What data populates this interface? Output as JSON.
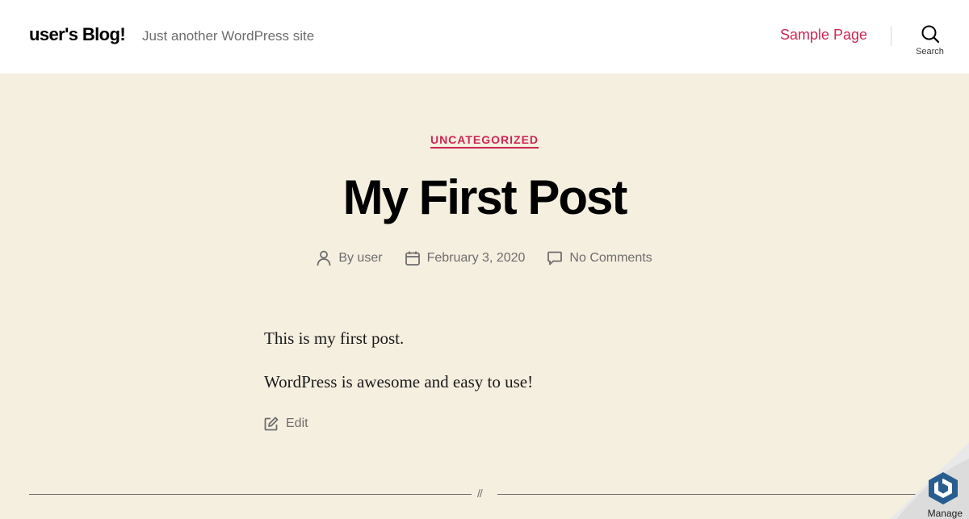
{
  "header": {
    "site_title": "user's Blog!",
    "tagline": "Just another WordPress site",
    "nav": [
      {
        "label": "Sample Page"
      }
    ],
    "search_label": "Search"
  },
  "post": {
    "category": "UNCATEGORIZED",
    "title": "My First Post",
    "meta": {
      "author": "By user",
      "date": "February 3, 2020",
      "comments": "No Comments"
    },
    "paragraphs": [
      "This is my first post.",
      "WordPress is awesome and easy to use!"
    ],
    "edit_label": "Edit"
  },
  "separator_mark": "//",
  "manage_badge": {
    "label": "Manage"
  },
  "colors": {
    "accent": "#cd2653",
    "background": "#f5efe0",
    "header_bg": "#ffffff",
    "meta_text": "#6d6d6d"
  },
  "icons": [
    "search-icon",
    "person-icon",
    "calendar-icon",
    "comment-icon",
    "edit-icon",
    "manage-logo-icon"
  ]
}
